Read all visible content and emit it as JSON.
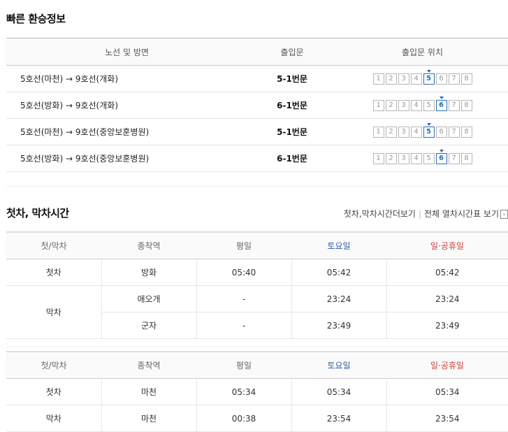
{
  "transfer": {
    "title": "빠른 환승정보",
    "headers": {
      "route": "노선 및 방면",
      "exit": "출입문",
      "position": "출입문 위치"
    },
    "rows": [
      {
        "route": "5호선(마천) → 9호선(개화)",
        "exit": "5-1번문",
        "door": 5
      },
      {
        "route": "5호선(방화) → 9호선(개화)",
        "exit": "6-1번문",
        "door": 6
      },
      {
        "route": "5호선(마천) → 9호선(중앙보훈병원)",
        "exit": "5-1번문",
        "door": 5
      },
      {
        "route": "5호선(방화) → 9호선(중앙보훈병원)",
        "exit": "6-1번문",
        "door": 6
      }
    ],
    "door_labels": [
      "1",
      "2",
      "3",
      "4",
      "5",
      "6",
      "7",
      "8"
    ],
    "accent_color": "#2a6db5"
  },
  "timetable": {
    "title": "첫차, 막차시간",
    "link_more": "첫차,막차시간더보기",
    "link_full": "전체 열차시간표 보기",
    "headers": {
      "type": "첫/막차",
      "terminal": "종착역",
      "weekday": "평일",
      "saturday": "토요일",
      "holiday": "일·공휴일"
    },
    "saturday_color": "#2a5da8",
    "holiday_color": "#d03a3a",
    "table1": {
      "first": {
        "type": "첫차",
        "terminal": "방화",
        "weekday": "05:40",
        "saturday": "05:42",
        "holiday": "05:42"
      },
      "last_type": "막차",
      "last": [
        {
          "terminal": "애오개",
          "weekday": "-",
          "saturday": "23:24",
          "holiday": "23:24"
        },
        {
          "terminal": "군자",
          "weekday": "-",
          "saturday": "23:49",
          "holiday": "23:49"
        }
      ]
    },
    "table2": {
      "first": {
        "type": "첫차",
        "terminal": "마천",
        "weekday": "05:34",
        "saturday": "05:34",
        "holiday": "05:34"
      },
      "last": {
        "type": "막차",
        "terminal": "마천",
        "weekday": "00:38",
        "saturday": "23:54",
        "holiday": "23:54"
      }
    }
  }
}
